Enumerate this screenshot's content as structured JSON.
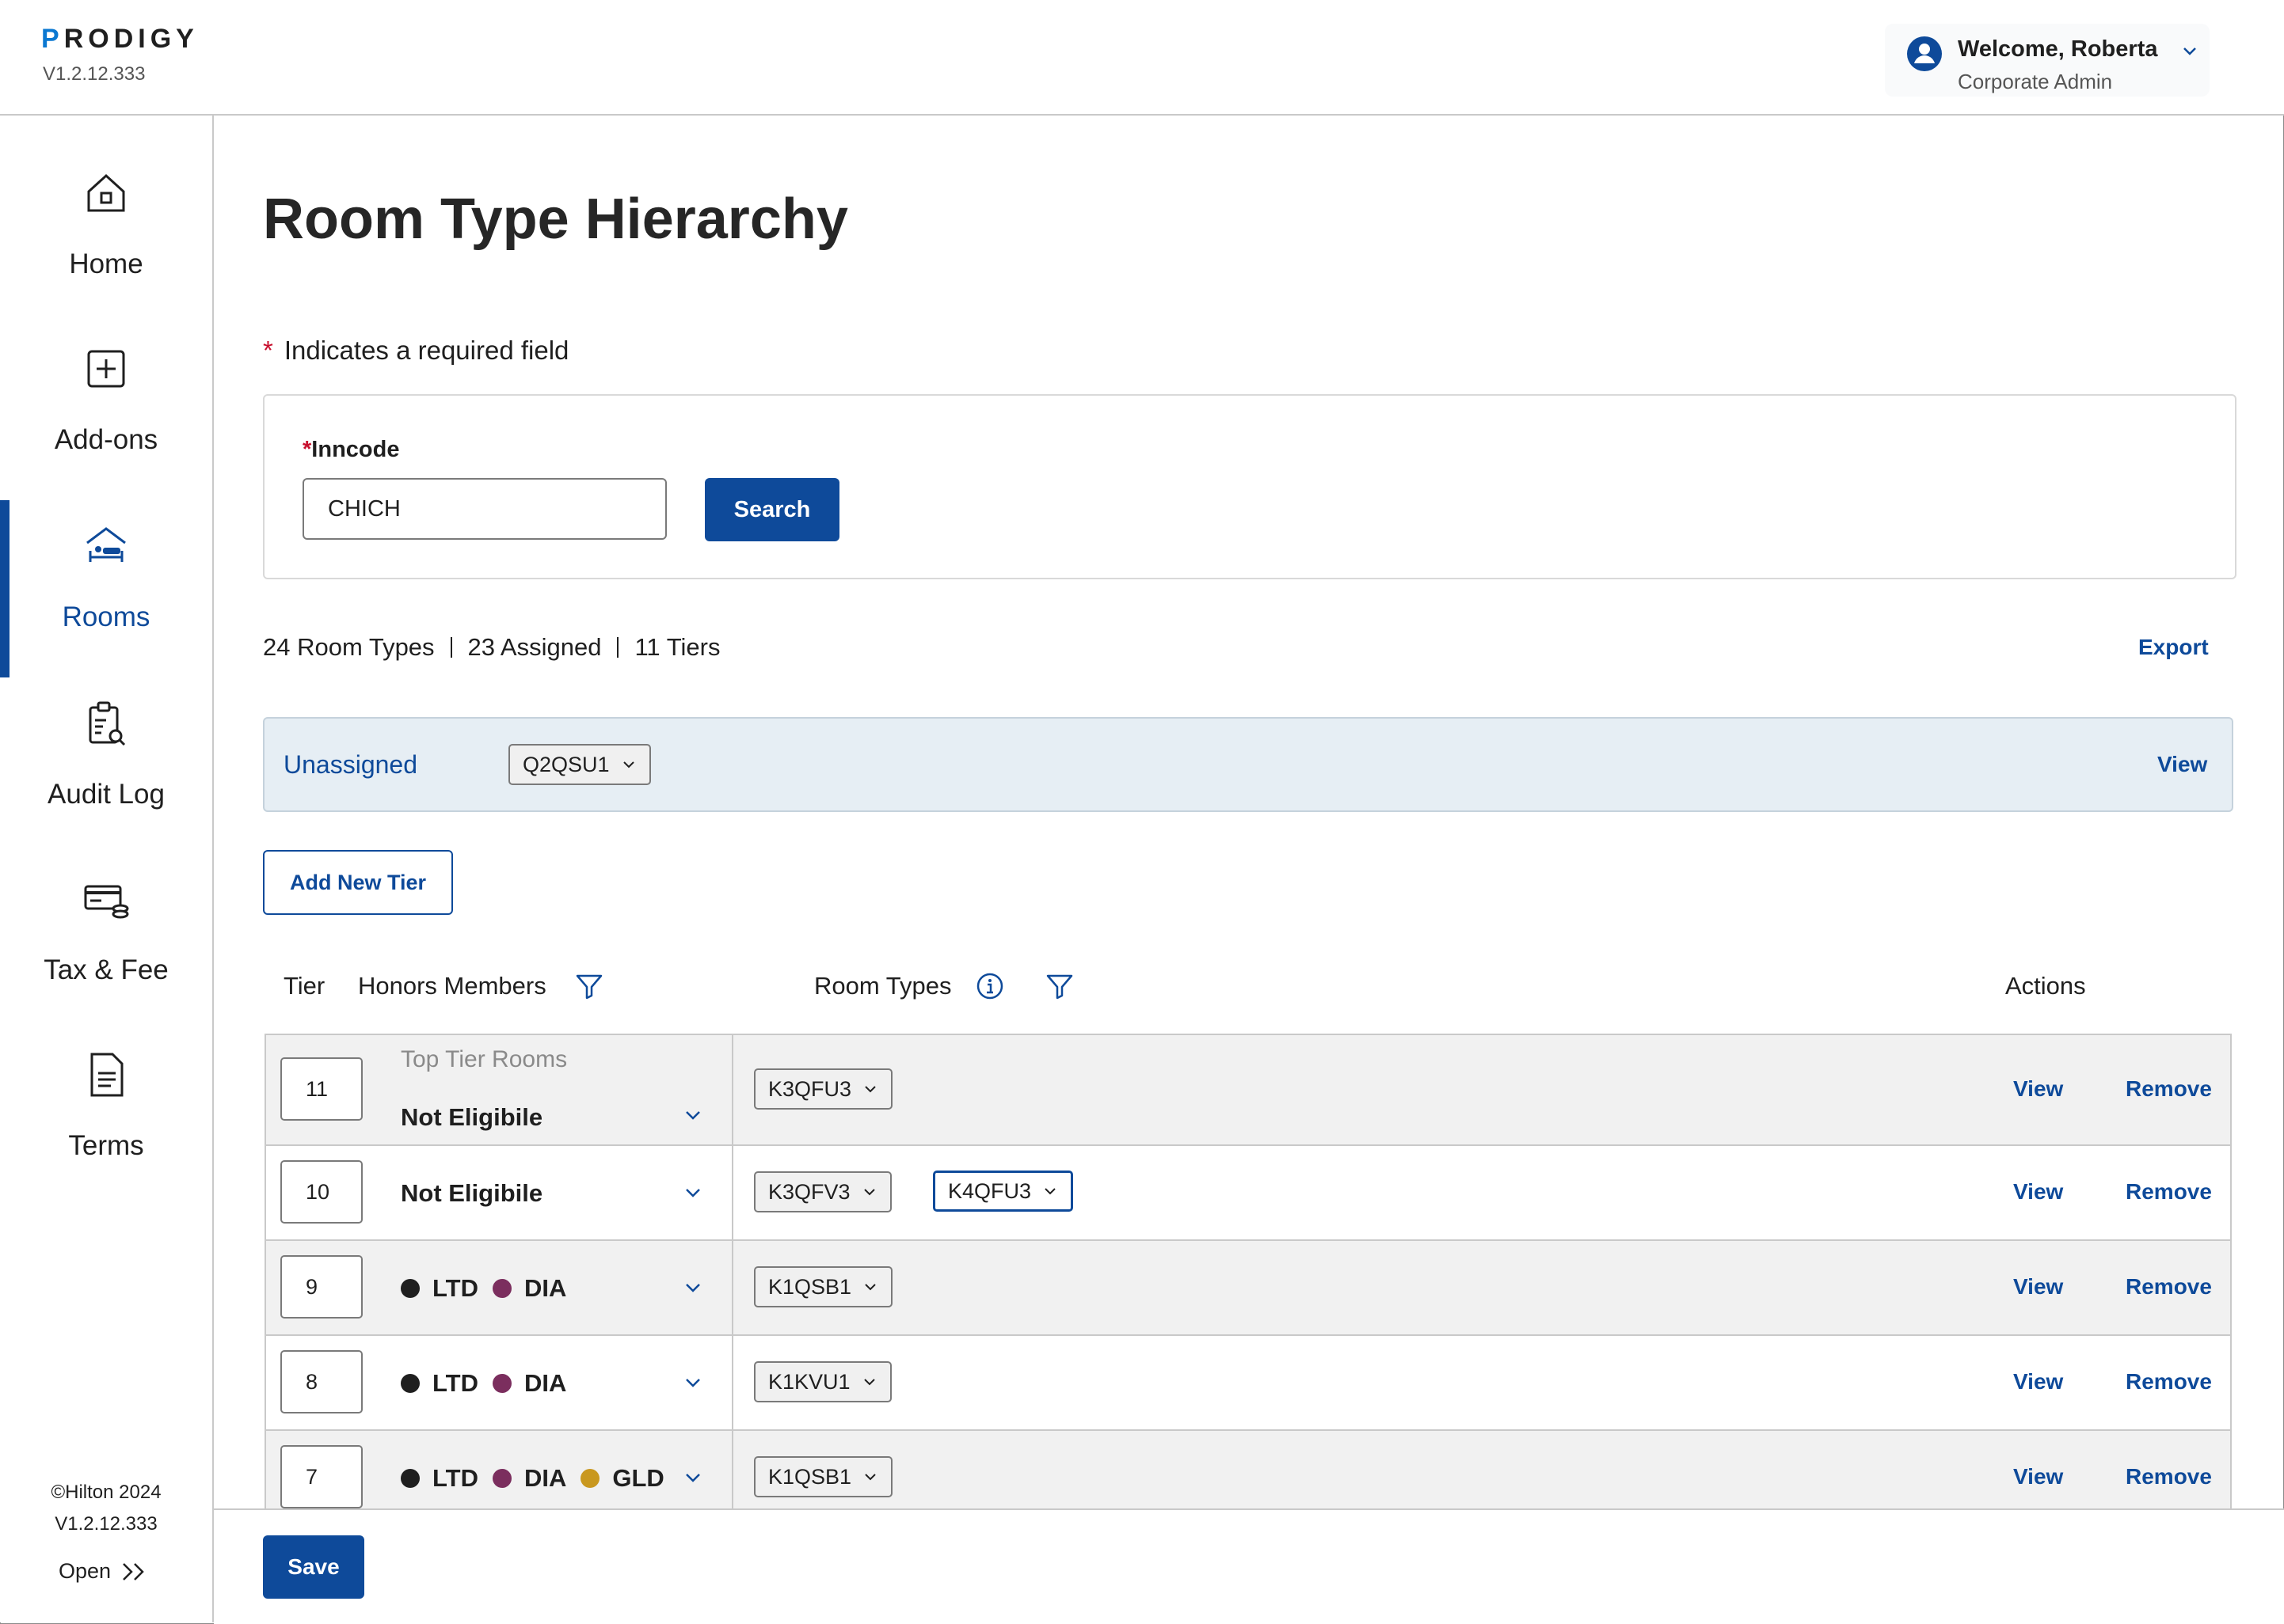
{
  "header": {
    "logo": "PRODIGY",
    "version": "V1.2.12.333",
    "user": {
      "welcome": "Welcome, Roberta",
      "role": "Corporate Admin"
    }
  },
  "sidebar": {
    "items": [
      {
        "label": "Home",
        "icon": "home-icon",
        "active": false
      },
      {
        "label": "Add-ons",
        "icon": "plus-square-icon",
        "active": false
      },
      {
        "label": "Rooms",
        "icon": "bed-icon",
        "active": true
      },
      {
        "label": "Audit Log",
        "icon": "clipboard-search-icon",
        "active": false
      },
      {
        "label": "Tax & Fee",
        "icon": "credit-card-coins-icon",
        "active": false
      },
      {
        "label": "Terms",
        "icon": "document-icon",
        "active": false
      }
    ],
    "copyright": "©Hilton 2024",
    "version": "V1.2.12.333",
    "open_label": "Open"
  },
  "page": {
    "title": "Room Type Hierarchy",
    "required_note": "Indicates a required field"
  },
  "search": {
    "label": "Inncode",
    "value": "CHICH",
    "button": "Search"
  },
  "stats": {
    "room_types": "24 Room Types",
    "assigned": "23 Assigned",
    "tiers": "11 Tiers",
    "export": "Export"
  },
  "unassigned": {
    "title": "Unassigned",
    "chip": "Q2QSU1",
    "view": "View"
  },
  "add_tier_label": "Add New Tier",
  "table": {
    "headers": {
      "tier": "Tier",
      "honors": "Honors Members",
      "room_types": "Room Types",
      "actions": "Actions"
    },
    "view_label": "View",
    "remove_label": "Remove",
    "rows": [
      {
        "tier": "11",
        "subtitle": "Top Tier Rooms",
        "honors_text": "Not Eligibile",
        "room_types": [
          "K3QFU3"
        ]
      },
      {
        "tier": "10",
        "honors_text": "Not Eligibile",
        "room_types": [
          "K3QFV3",
          "K4QFU3"
        ]
      },
      {
        "tier": "9",
        "honors": [
          "LTD",
          "DIA"
        ],
        "room_types": [
          "K1QSB1"
        ]
      },
      {
        "tier": "8",
        "honors": [
          "LTD",
          "DIA"
        ],
        "room_types": [
          "K1KVU1"
        ]
      },
      {
        "tier": "7",
        "honors": [
          "LTD",
          "DIA",
          "GLD"
        ],
        "room_types": [
          "K1QSB1"
        ]
      }
    ]
  },
  "colors": {
    "primary": "#0e4a9a",
    "required": "#c8102e",
    "ltd": "#1f1f1f",
    "dia": "#7b2e5e",
    "gld": "#c9981f",
    "unassigned_bg": "#e6eef4"
  },
  "save_label": "Save"
}
